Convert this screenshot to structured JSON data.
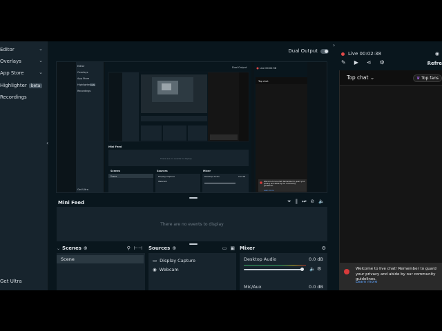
{
  "sidebar": {
    "items": [
      {
        "label": "Editor",
        "chevron": "chevron-down-icon"
      },
      {
        "label": "Overlays",
        "chevron": "chevron-down-icon"
      },
      {
        "label": "App Store",
        "chevron": "chevron-down-icon"
      },
      {
        "label": "Highlighter",
        "badge": "beta"
      },
      {
        "label": "Recordings"
      }
    ],
    "footer": "Get Ultra"
  },
  "header": {
    "dual_output_label": "Dual Output"
  },
  "preview_inner": {
    "sidebar_items": [
      "Editor",
      "Overlays",
      "App Store",
      "Highlighter",
      "Recordings"
    ],
    "highlighter_badge": "beta",
    "footer": "Get Ultra",
    "dual_output": "Dual Output",
    "live": "Live 00:02:38",
    "top_chat": "Top chat",
    "mini_feed": "Mini Feed",
    "mini_empty": "There are no events to display",
    "scenes": "Scenes",
    "scene_item": "Scene",
    "sources": "Sources",
    "source_items": [
      "Display Capture",
      "Webcam"
    ],
    "mixer": "Mixer",
    "mixer_item": "Desktop Audio",
    "mixer_value": "0.0 dB",
    "notice": "Welcome to live chat! Remember to guard your privacy and abide by our community guidelines.",
    "learn_more": "Learn more"
  },
  "mini_feed": {
    "title": "Mini Feed",
    "empty_text": "There are no events to display",
    "icons": [
      "filter-icon",
      "pause-icon",
      "skip-icon",
      "mute-icon",
      "volume-icon"
    ]
  },
  "scenes": {
    "title": "Scenes",
    "items": [
      "Scene"
    ]
  },
  "sources": {
    "title": "Sources",
    "items": [
      {
        "label": "Display Capture",
        "icon": "monitor-icon"
      },
      {
        "label": "Webcam",
        "icon": "webcam-icon"
      }
    ]
  },
  "mixer": {
    "title": "Mixer",
    "channels": [
      {
        "name": "Desktop Audio",
        "value": "0.0 dB"
      },
      {
        "name": "Mic/Aux",
        "value": "0.0 dB"
      }
    ]
  },
  "chat": {
    "live_label": "Live 00:02:38",
    "refresh_label": "Refre",
    "top_chat": "Top chat",
    "top_fans": "Top fans",
    "notice_text": "Welcome to live chat! Remember to guard your privacy and abide by our community guidelines.",
    "learn_more": "Learn more"
  },
  "colors": {
    "accent": "#e24a4a",
    "link": "#5ea4ff",
    "panel": "#17242d",
    "background": "#09161d"
  }
}
